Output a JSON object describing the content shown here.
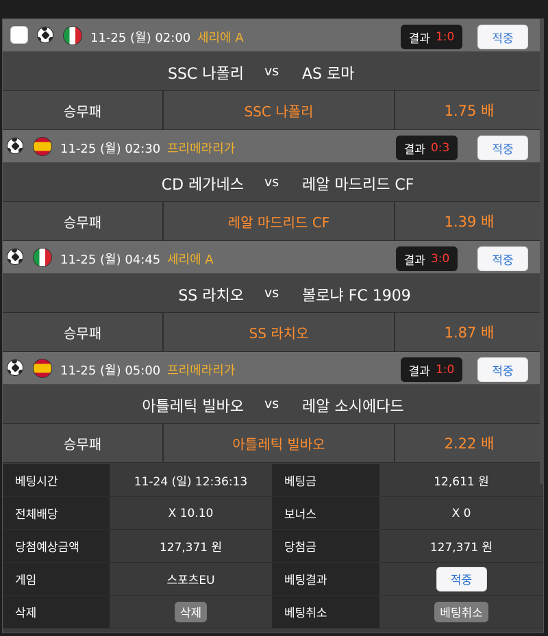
{
  "matches": [
    {
      "datetime": "11-25 (월) 02:00",
      "league": "세리에 A",
      "flag": "italy-flag-icon",
      "result_label": "결과",
      "score": "1:0",
      "status": "적중",
      "home": "SSC 나폴리",
      "vs": "vs",
      "away": "AS 로마",
      "bet_type": "승무패",
      "selection": "SSC 나폴리",
      "odds": "1.75 배"
    },
    {
      "datetime": "11-25 (월) 02:30",
      "league": "프리메라리가",
      "flag": "spain-flag-icon",
      "result_label": "결과",
      "score": "0:3",
      "status": "적중",
      "home": "CD 레가네스",
      "vs": "vs",
      "away": "레알 마드리드 CF",
      "bet_type": "승무패",
      "selection": "레알 마드리드 CF",
      "odds": "1.39 배"
    },
    {
      "datetime": "11-25 (월) 04:45",
      "league": "세리에 A",
      "flag": "italy-flag-icon",
      "result_label": "결과",
      "score": "3:0",
      "status": "적중",
      "home": "SS 라치오",
      "vs": "vs",
      "away": "볼로냐 FC 1909",
      "bet_type": "승무패",
      "selection": "SS 라치오",
      "odds": "1.87 배"
    },
    {
      "datetime": "11-25 (월) 05:00",
      "league": "프리메라리가",
      "flag": "spain-flag-icon",
      "result_label": "결과",
      "score": "1:0",
      "status": "적중",
      "home": "아틀레틱 빌바오",
      "vs": "vs",
      "away": "레알 소시에다드",
      "bet_type": "승무패",
      "selection": "아틀레틱 빌바오",
      "odds": "2.22 배"
    }
  ],
  "summary": {
    "bet_time_label": "베팅시간",
    "bet_time": "11-24 (일) 12:36:13",
    "bet_amount_label": "베팅금",
    "bet_amount": "12,611 원",
    "total_odds_label": "전체배당",
    "total_odds": "X 10.10",
    "bonus_label": "보너스",
    "bonus": "X 0",
    "expected_label": "당첨예상금액",
    "expected": "127,371 원",
    "winnings_label": "당첨금",
    "winnings": "127,371 원",
    "game_label": "게임",
    "game": "스포츠EU",
    "bet_result_label": "베팅결과",
    "bet_result": "적중",
    "delete_label": "삭제",
    "delete_button": "삭제",
    "cancel_label": "베팅취소",
    "cancel_button": "베팅취소"
  },
  "colors": {
    "accent_orange": "#ff8c2e",
    "league_yellow": "#f2b12b",
    "score_red": "#ff3b30",
    "hit_blue": "#2c73d1"
  }
}
